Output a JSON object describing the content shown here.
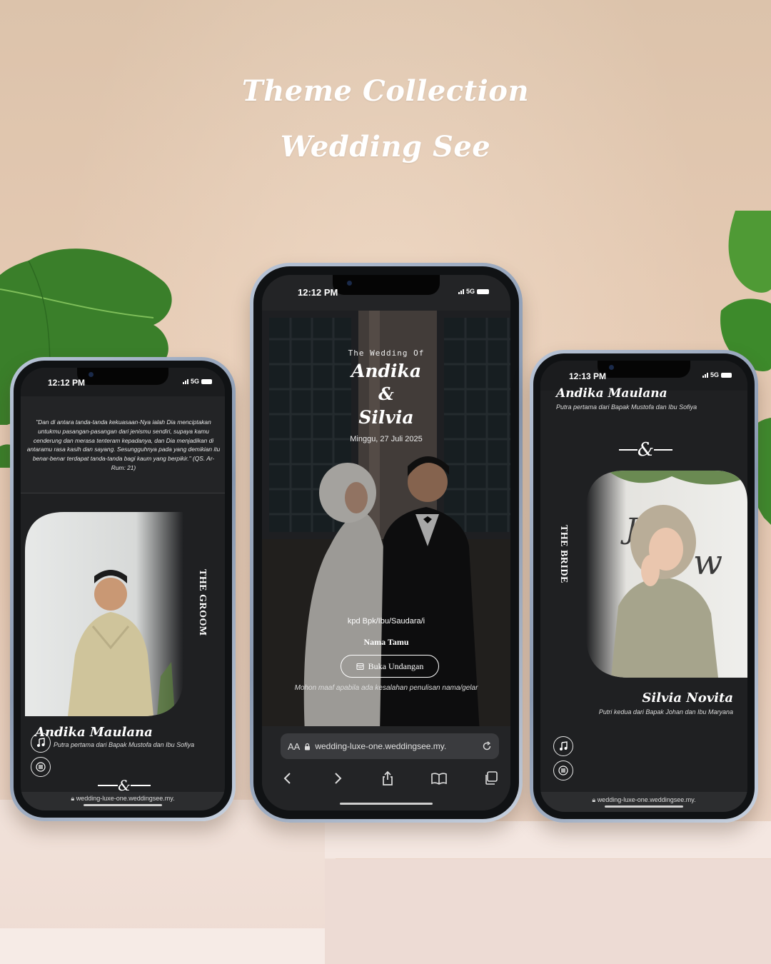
{
  "heading": {
    "line1": "Theme Collection",
    "line2": "Wedding See"
  },
  "phone_left": {
    "time": "12:12 PM",
    "network": "5G",
    "quote": "\"Dan di antara tanda-tanda kekuasaan-Nya ialah Dia menciptakan untukmu pasangan-pasangan dari jenismu sendiri, supaya kamu cenderung dan merasa tenteram kepadanya, dan Dia menjadikan di antaramu rasa kasih dan sayang. Sesungguhnya pada yang demikian itu benar-benar terdapat tanda-tanda bagi kaum yang berpikir.\" (QS. Ar-Rum: 21)",
    "side_label": "THE GROOM",
    "name": "Andika Maulana",
    "parents": "Putra pertama dari Bapak Mustofa dan Ibu Sofiya",
    "url": "wedding-luxe-one.weddingsee.my."
  },
  "phone_center": {
    "time": "12:12 PM",
    "network": "5G",
    "kicker": "The Wedding Of",
    "name1": "Andika",
    "amp": "&",
    "name2": "Silvia",
    "date": "Minggu, 27 Juli 2025",
    "to_label": "kpd Bpk/Ibu/Saudara/i",
    "guest": "Nama Tamu",
    "open_button": "Buka Undangan",
    "apology": "Mohon maaf apabila ada kesalahan penulisan nama/gelar",
    "url_aa": "AA",
    "url": "wedding-luxe-one.weddingsee.my."
  },
  "phone_right": {
    "time": "12:13 PM",
    "network": "5G",
    "groom_name": "Andika Maulana",
    "groom_parents": "Putra pertama dari Bapak Mustofa dan Ibu Sofiya",
    "side_label": "THE BRIDE",
    "bride_name": "Silvia Novita",
    "bride_parents": "Putri kedua dari Bapak Johan dan Ibu Maryana",
    "url": "wedding-luxe-one.weddingsee.my."
  },
  "colors": {
    "wall": "#e4c9b2",
    "screen_bg": "#1f2022",
    "leaf": "#3f8a2e",
    "frame": "#9aa8bd"
  },
  "icons": [
    "music-icon",
    "menu-icon",
    "lock-icon",
    "reload-icon",
    "back-icon",
    "forward-icon",
    "share-icon",
    "book-icon",
    "tabs-icon",
    "envelope-icon"
  ]
}
